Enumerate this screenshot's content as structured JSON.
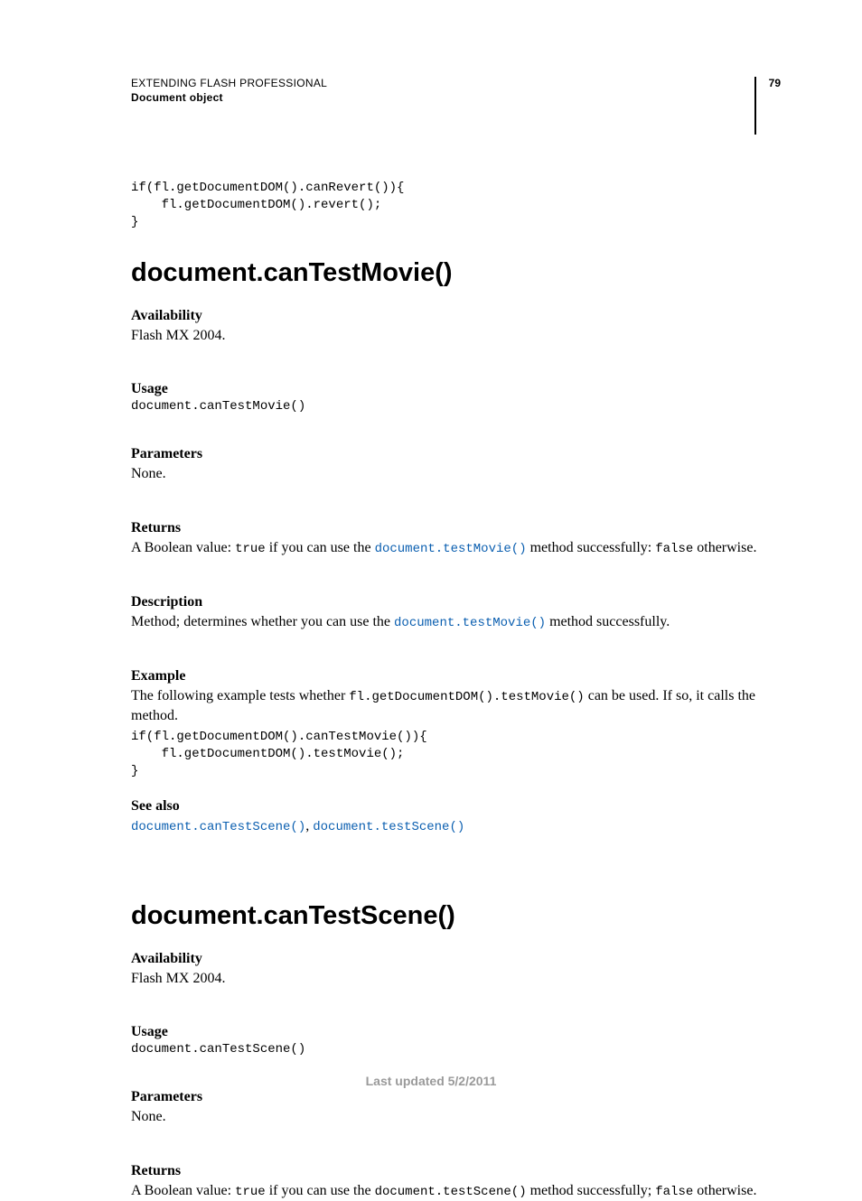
{
  "header": {
    "title": "EXTENDING FLASH PROFESSIONAL",
    "subtitle": "Document object",
    "page_number": "79"
  },
  "intro_code": "if(fl.getDocumentDOM().canRevert()){\n    fl.getDocumentDOM().revert();\n}",
  "section1": {
    "title": "document.canTestMovie()",
    "availability_h": "Availability",
    "availability_t": "Flash MX 2004.",
    "usage_h": "Usage",
    "usage_code": "document.canTestMovie()",
    "parameters_h": "Parameters",
    "parameters_t": "None.",
    "returns_h": "Returns",
    "returns_pre": "A Boolean value: ",
    "returns_true": "true",
    "returns_mid": " if you can use the ",
    "returns_link": "document.testMovie()",
    "returns_post1": " method successfully: ",
    "returns_false": "false",
    "returns_post2": " otherwise.",
    "description_h": "Description",
    "description_pre": "Method; determines whether you can use the ",
    "description_link": "document.testMovie()",
    "description_post": " method successfully.",
    "example_h": "Example",
    "example_pre": "The following example tests whether ",
    "example_code_inline": "fl.getDocumentDOM().testMovie()",
    "example_post": " can be used. If so, it calls the method.",
    "example_code": "if(fl.getDocumentDOM().canTestMovie()){\n    fl.getDocumentDOM().testMovie();\n}",
    "seealso_h": "See also",
    "seealso_link1": "document.canTestScene()",
    "seealso_sep": ", ",
    "seealso_link2": "document.testScene()"
  },
  "section2": {
    "title": "document.canTestScene()",
    "availability_h": "Availability",
    "availability_t": "Flash MX 2004.",
    "usage_h": "Usage",
    "usage_code": "document.canTestScene()",
    "parameters_h": "Parameters",
    "parameters_t": "None.",
    "returns_h": "Returns",
    "returns_pre": "A Boolean value: ",
    "returns_true": "true",
    "returns_mid": " if you can use the ",
    "returns_code": "document.testScene()",
    "returns_post1": " method successfully; ",
    "returns_false": "false",
    "returns_post2": " otherwise."
  },
  "footer": "Last updated 5/2/2011"
}
